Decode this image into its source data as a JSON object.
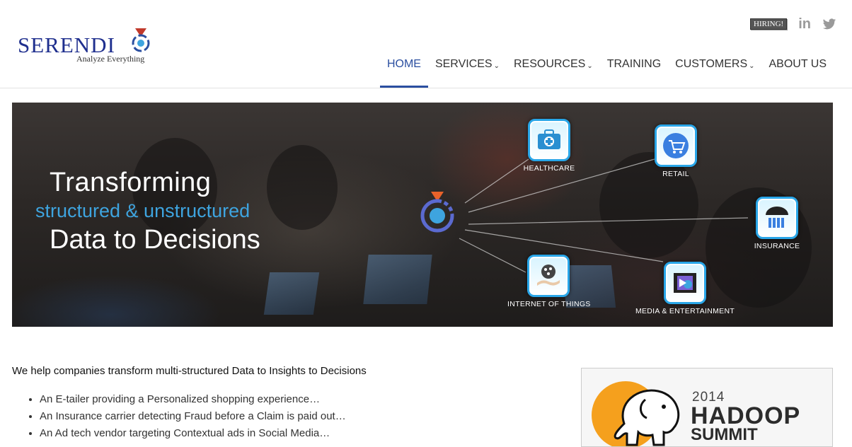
{
  "logo": {
    "name": "SERENDI",
    "tagline": "Analyze Everything"
  },
  "top": {
    "hiring": "HIRING!",
    "linkedin": "in",
    "twitter_icon": "twitter-icon"
  },
  "nav": {
    "home": "HOME",
    "services": "SERVICES",
    "resources": "RESOURCES",
    "training": "TRAINING",
    "customers": "CUSTOMERS",
    "about": "ABOUT US",
    "caret": "⌄"
  },
  "banner": {
    "line1": "Transforming",
    "line2": "structured & unstructured",
    "line3": "Data to Decisions",
    "nodes": {
      "healthcare": "HEALTHCARE",
      "retail": "RETAIL",
      "insurance": "INSURANCE",
      "iot": "INTERNET OF THINGS",
      "media": "MEDIA & ENTERTAINMENT"
    }
  },
  "content": {
    "intro": "We help companies transform multi-structured Data to Insights to Decisions",
    "bullets": [
      "An E-tailer providing a Personalized shopping experience…",
      "An Insurance carrier detecting Fraud before a Claim is paid out…",
      "An Ad tech vendor targeting Contextual ads in Social Media…"
    ]
  },
  "ad": {
    "year": "2014",
    "title": "HADOOP",
    "subtitle": "SUMMIT"
  },
  "colors": {
    "brand_blue": "#1f2f8e",
    "accent": "#2b4fa0",
    "banner_text_blue": "#3ea4df",
    "node_border": "#29a6e8"
  }
}
